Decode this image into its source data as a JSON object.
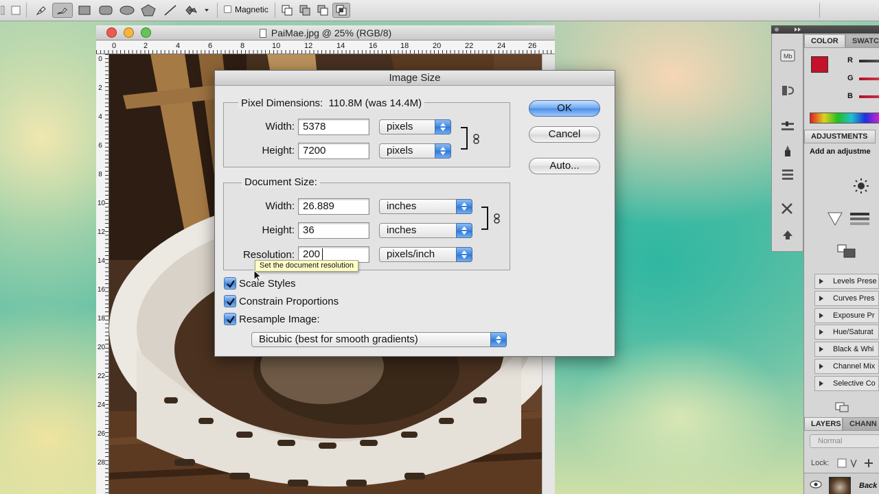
{
  "options_bar": {
    "magnetic_label": "Magnetic",
    "tools": [
      "pen-tool-icon",
      "freeform-pen-icon",
      "rectangle-shape-icon",
      "rounded-rectangle-icon",
      "ellipse-icon",
      "polygon-icon",
      "line-icon",
      "custom-shape-icon"
    ]
  },
  "document": {
    "title": "PaiMae.jpg @ 25% (RGB/8)",
    "ruler_h": [
      "0",
      "2",
      "4",
      "6",
      "8",
      "10",
      "12",
      "14",
      "16",
      "18",
      "20",
      "22",
      "24",
      "26"
    ],
    "ruler_v": [
      "0",
      "2",
      "4",
      "6",
      "8",
      "10",
      "12",
      "14",
      "16",
      "18",
      "20",
      "22",
      "24",
      "26",
      "28"
    ]
  },
  "dialog": {
    "title": "Image Size",
    "pixel_dimensions": {
      "title": "Pixel Dimensions:",
      "size_info": "110.8M (was 14.4M)",
      "width_label": "Width:",
      "width_value": "5378",
      "width_unit": "pixels",
      "height_label": "Height:",
      "height_value": "7200",
      "height_unit": "pixels"
    },
    "document_size": {
      "title": "Document Size:",
      "width_label": "Width:",
      "width_value": "26.889",
      "width_unit": "inches",
      "height_label": "Height:",
      "height_value": "36",
      "height_unit": "inches",
      "resolution_label": "Resolution:",
      "resolution_value": "200",
      "resolution_unit": "pixels/inch"
    },
    "tooltip": "Set the document resolution",
    "checkboxes": {
      "scale_styles": "Scale Styles",
      "constrain_proportions": "Constrain Proportions",
      "resample_image": "Resample Image:"
    },
    "resample_method": "Bicubic (best for smooth gradients)",
    "buttons": {
      "ok": "OK",
      "cancel": "Cancel",
      "auto": "Auto..."
    }
  },
  "panels": {
    "color_tab": "COLOR",
    "swatches_tab": "SWATC",
    "channel_labels": [
      "R",
      "G",
      "B"
    ],
    "foreground_color": "#c4122a",
    "adjustments_tab": "ADJUSTMENTS",
    "adjustments_prompt": "Add an adjustme",
    "presets": [
      "Levels Prese",
      "Curves Pres",
      "Exposure Pr",
      "Hue/Saturat",
      "Black & Whi",
      "Channel Mix",
      "Selective Co"
    ],
    "layers_tab": "LAYERS",
    "channels_tab": "CHANN",
    "blend_mode": "Normal",
    "lock_label": "Lock:",
    "layer_name": "Back"
  },
  "colors": {
    "accent_blue": "#3d85e0",
    "dialog_bg": "#e8e8e8",
    "tooltip_bg": "#fffdc8"
  }
}
